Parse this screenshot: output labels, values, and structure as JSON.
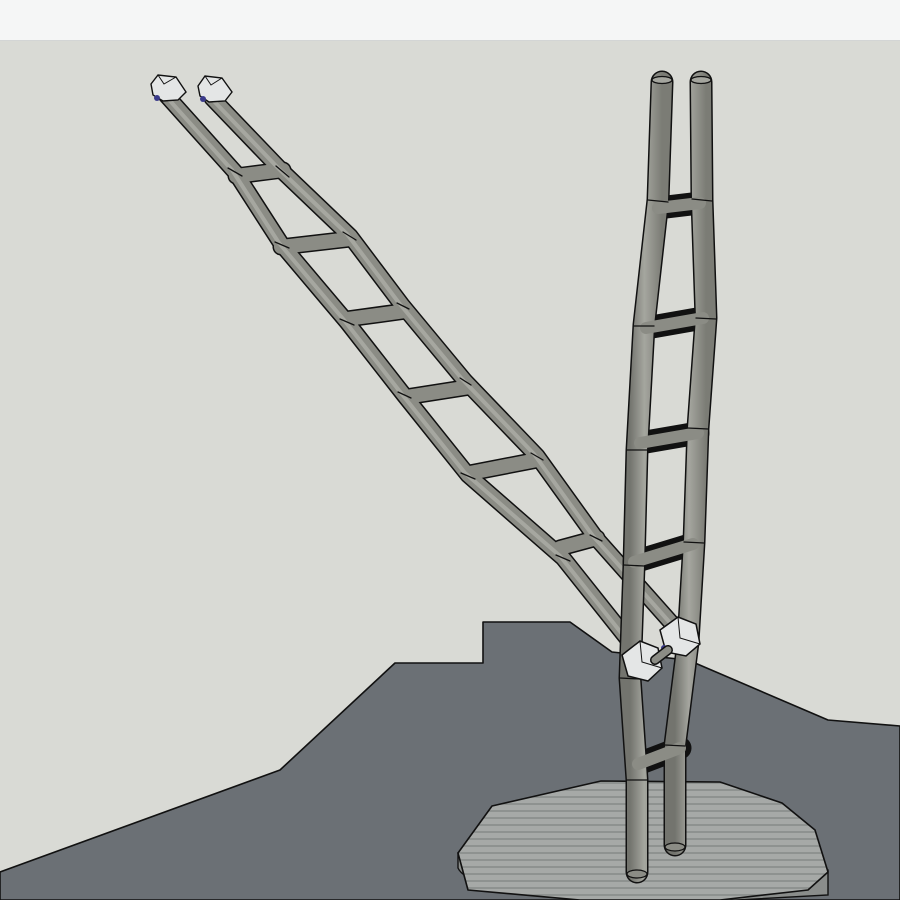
{
  "app": {
    "kind": "3D modeling viewport",
    "toolbar_label": ""
  },
  "scene": {
    "objects": [
      "ground-terrain",
      "circular-deck",
      "upright-ladder",
      "swinging-boom-ladder",
      "hinge-brackets",
      "tip-clamps"
    ]
  },
  "colors": {
    "sky": "#d9dad5",
    "toolbar": "#f5f6f6",
    "ground": "#6b7075",
    "deck": "#9fa2a0",
    "tube": "#8b8c85",
    "tube_highlight": "#a9aaa3",
    "clamp": "#e4e6e6",
    "bolt": "#3a3a8a",
    "edge": "#111111"
  }
}
